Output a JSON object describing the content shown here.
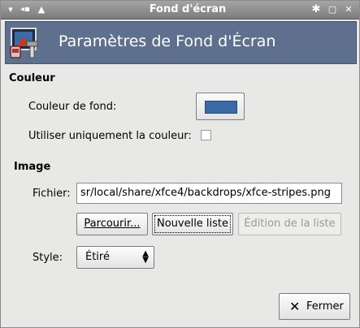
{
  "window": {
    "title": "Fond d'écran",
    "left_controls": [
      "▾",
      "◂▪",
      "▲"
    ],
    "right_controls": [
      "✱",
      "▢",
      "✕"
    ]
  },
  "banner": {
    "title": "Paramètres de Fond d'Écran",
    "icon": "wallpaper-settings-icon"
  },
  "color_section": {
    "heading": "Couleur",
    "background_label": "Couleur de fond:",
    "background_color": "#3b6ba6",
    "only_color_label": "Utiliser uniquement la couleur:",
    "only_color_checked": false
  },
  "image_section": {
    "heading": "Image",
    "file_label": "Fichier:",
    "file_value": "sr/local/share/xfce4/backdrops/xfce-stripes.png",
    "browse_label": "Parcourir...",
    "new_list_label": "Nouvelle liste",
    "edit_list_label": "Édition de la liste",
    "style_label": "Style:",
    "style_value": "Étiré"
  },
  "footer": {
    "close_label": "Fermer"
  }
}
